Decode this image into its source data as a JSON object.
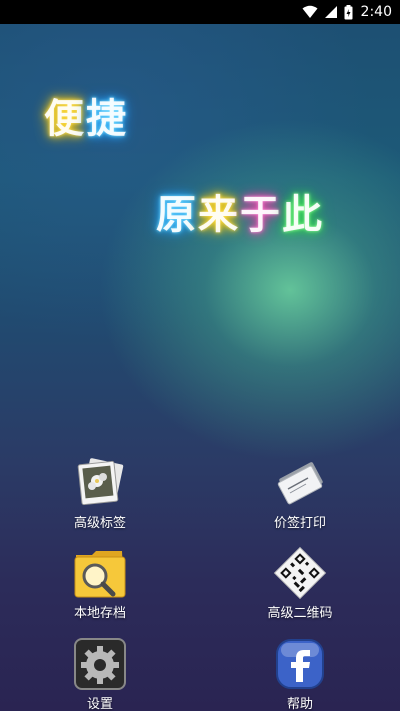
{
  "status_bar": {
    "time": "2:40",
    "icons": [
      "wifi-icon",
      "cellular-signal-icon",
      "battery-icon"
    ]
  },
  "slogan": {
    "line1": [
      "便",
      "捷"
    ],
    "line2": [
      "原",
      "来",
      "于",
      "此"
    ]
  },
  "menu": {
    "advanced_label": "高级标签",
    "price_print": "价签打印",
    "local_archive": "本地存档",
    "advanced_qr": "高级二维码",
    "settings": "设置",
    "help": "帮助"
  },
  "colors": {
    "status_bar_bg": "#000000",
    "neon_yellow": "#ffd21a",
    "neon_blue": "#2fb9ff",
    "neon_pink": "#ff4fb8",
    "neon_green": "#3fe85a",
    "neon_cyan": "#3fe6e6"
  }
}
